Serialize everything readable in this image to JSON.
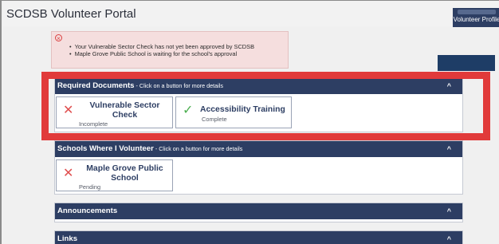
{
  "app": {
    "title": "SCDSB Volunteer Portal",
    "profile_button": "Volunteer Profile"
  },
  "alert": {
    "icon": "error-circle-icon",
    "messages": [
      "Your Vulnerable Sector Check has not yet been approved by SCDSB",
      "Maple Grove Public School is waiting for the school's approval"
    ]
  },
  "sections": {
    "required_documents": {
      "title": "Required Documents",
      "hint": " - Click on a button for more details",
      "cards": [
        {
          "title": "Vulnerable Sector Check",
          "status": "Incomplete",
          "icon": "x-icon"
        },
        {
          "title": "Accessibility Training",
          "status": "Complete",
          "icon": "check-icon"
        }
      ]
    },
    "schools": {
      "title": "Schools Where I Volunteer",
      "hint": " - Click on a button for more details",
      "cards": [
        {
          "title": "Maple Grove Public School",
          "status": "Pending",
          "icon": "x-icon"
        }
      ]
    },
    "announcements": {
      "title": "Announcements"
    },
    "links": {
      "title": "Links"
    }
  },
  "colors": {
    "header_navy": "#2d3e63",
    "highlight_red": "#e13a3a",
    "alert_bg": "#f5dede",
    "error_red": "#e05050",
    "success_green": "#4caf50"
  }
}
